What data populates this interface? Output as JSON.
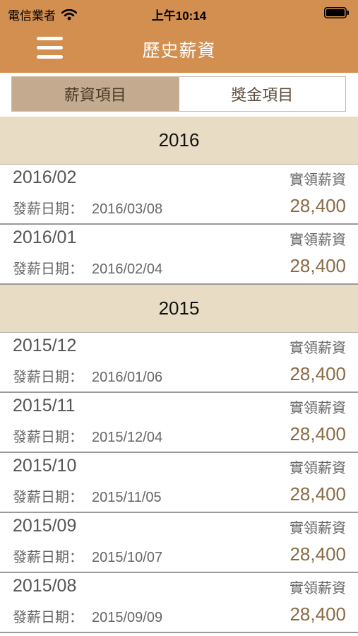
{
  "status_bar": {
    "carrier": "電信業者",
    "time": "上午10:14"
  },
  "nav": {
    "title": "歷史薪資"
  },
  "tabs": [
    {
      "label": "薪資項目",
      "selected": true
    },
    {
      "label": "獎金項目",
      "selected": false
    }
  ],
  "colors": {
    "header": "#d38f50",
    "tab_selected": "#c4ab8f",
    "section_header": "#e9dcc4",
    "amount": "#8a6a45"
  },
  "payroll": {
    "pay_date_label": "發薪日期：",
    "net_pay_label": "實領薪資",
    "sections": [
      {
        "year": "2016",
        "rows": [
          {
            "month": "2016/02",
            "pay_date": "2016/03/08",
            "amount": "28,400"
          },
          {
            "month": "2016/01",
            "pay_date": "2016/02/04",
            "amount": "28,400"
          }
        ]
      },
      {
        "year": "2015",
        "rows": [
          {
            "month": "2015/12",
            "pay_date": "2016/01/06",
            "amount": "28,400"
          },
          {
            "month": "2015/11",
            "pay_date": "2015/12/04",
            "amount": "28,400"
          },
          {
            "month": "2015/10",
            "pay_date": "2015/11/05",
            "amount": "28,400"
          },
          {
            "month": "2015/09",
            "pay_date": "2015/10/07",
            "amount": "28,400"
          },
          {
            "month": "2015/08",
            "pay_date": "2015/09/09",
            "amount": "28,400"
          }
        ]
      }
    ]
  }
}
